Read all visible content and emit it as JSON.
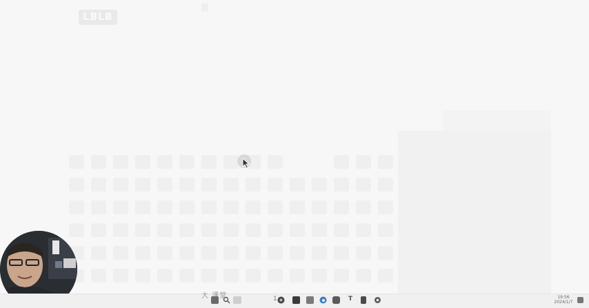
{
  "app": {
    "title_chip": "LBLB"
  },
  "cursor": {
    "icon": "mouse-pointer-icon"
  },
  "webcam": {
    "icon": "presenter-webcam-overlay"
  },
  "taskbar": {
    "watermark_text": "大 课堂",
    "text_item": "T",
    "clock_time": "19:56",
    "clock_date": "2024/1/7",
    "icons": [
      "start-icon",
      "search-icon",
      "taskview-icon",
      "chrome-icon",
      "files-icon",
      "edge-icon",
      "camera-icon",
      "text-icon",
      "document-icon",
      "settings-icon"
    ],
    "colors": {
      "start": "#6a6a6a",
      "edge": "#3d7fbf",
      "chrome": "#444444",
      "files": "#7a7a7a",
      "settings": "#5a5a5a"
    }
  }
}
